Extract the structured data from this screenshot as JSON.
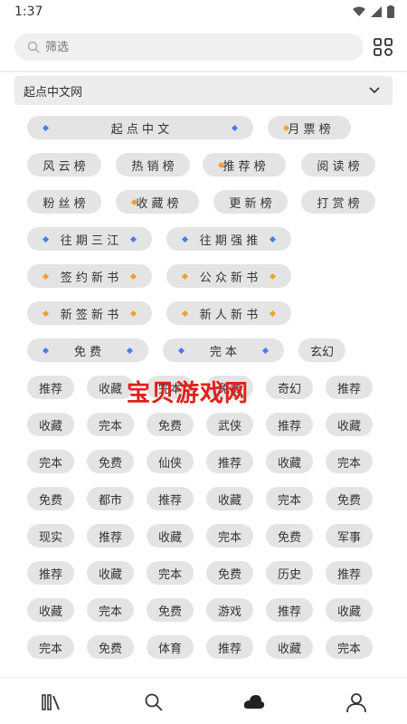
{
  "status": {
    "time": "1:37"
  },
  "search": {
    "placeholder": "筛选"
  },
  "source": {
    "selected": "起点中文网"
  },
  "tags": [
    {
      "label": "起 点 中 文",
      "dots": "both",
      "colors": [
        "#4a7be8",
        "#4a7be8"
      ]
    },
    {
      "label": "月 票 榜",
      "dots": "left",
      "colors": [
        "#f0a030"
      ]
    },
    {
      "label": "风 云 榜",
      "dots": "none"
    },
    {
      "label": "热 销 榜",
      "dots": "none"
    },
    {
      "label": "推 荐 榜",
      "dots": "left",
      "colors": [
        "#f0a030"
      ]
    },
    {
      "label": "阅 读 榜",
      "dots": "none"
    },
    {
      "label": "粉 丝 榜",
      "dots": "none"
    },
    {
      "label": "收 藏 榜",
      "dots": "left",
      "colors": [
        "#f0a030"
      ]
    },
    {
      "label": "更 新 榜",
      "dots": "none"
    },
    {
      "label": "打 赏 榜",
      "dots": "none"
    },
    {
      "label": "往 期 三 江",
      "dots": "both",
      "colors": [
        "#4a7be8",
        "#4a7be8"
      ]
    },
    {
      "label": "往 期 强 推",
      "dots": "both",
      "colors": [
        "#4a7be8",
        "#4a7be8"
      ]
    },
    {
      "label": "签 约 新 书",
      "dots": "both",
      "colors": [
        "#f0a030",
        "#f0a030"
      ]
    },
    {
      "label": "公 众 新 书",
      "dots": "both",
      "colors": [
        "#f0a030",
        "#f0a030"
      ]
    },
    {
      "label": "新 签 新 书",
      "dots": "both",
      "colors": [
        "#f0a030",
        "#f0a030"
      ]
    },
    {
      "label": "新 人 新 书",
      "dots": "both",
      "colors": [
        "#f0a030",
        "#f0a030"
      ]
    },
    {
      "label": "免 费",
      "dots": "both",
      "colors": [
        "#4a7be8",
        "#4a7be8"
      ]
    },
    {
      "label": "完 本",
      "dots": "both",
      "colors": [
        "#4a7be8",
        "#4a7be8"
      ]
    },
    {
      "label": "玄幻",
      "dots": "none"
    },
    {
      "label": "推荐"
    },
    {
      "label": "收藏"
    },
    {
      "label": "完本"
    },
    {
      "label": "免费"
    },
    {
      "label": "奇幻"
    },
    {
      "label": "推荐"
    },
    {
      "label": "收藏"
    },
    {
      "label": "完本"
    },
    {
      "label": "免费"
    },
    {
      "label": "武侠"
    },
    {
      "label": "推荐"
    },
    {
      "label": "收藏"
    },
    {
      "label": "完本"
    },
    {
      "label": "免费"
    },
    {
      "label": "仙侠"
    },
    {
      "label": "推荐"
    },
    {
      "label": "收藏"
    },
    {
      "label": "完本"
    },
    {
      "label": "免费"
    },
    {
      "label": "都市"
    },
    {
      "label": "推荐"
    },
    {
      "label": "收藏"
    },
    {
      "label": "完本"
    },
    {
      "label": "免费"
    },
    {
      "label": "现实"
    },
    {
      "label": "推荐"
    },
    {
      "label": "收藏"
    },
    {
      "label": "完本"
    },
    {
      "label": "免费"
    },
    {
      "label": "军事"
    },
    {
      "label": "推荐"
    },
    {
      "label": "收藏"
    },
    {
      "label": "完本"
    },
    {
      "label": "免费"
    },
    {
      "label": "历史"
    },
    {
      "label": "推荐"
    },
    {
      "label": "收藏"
    },
    {
      "label": "完本"
    },
    {
      "label": "免费"
    },
    {
      "label": "游戏"
    },
    {
      "label": "推荐"
    },
    {
      "label": "收藏"
    },
    {
      "label": "完本"
    },
    {
      "label": "免费"
    },
    {
      "label": "体育"
    },
    {
      "label": "推荐"
    },
    {
      "label": "收藏"
    },
    {
      "label": "完本"
    }
  ],
  "watermark": "宝贝游戏网",
  "nav": {
    "items": [
      {
        "icon": "bookshelf-icon"
      },
      {
        "icon": "search-icon"
      },
      {
        "icon": "cloud-icon"
      },
      {
        "icon": "user-icon"
      }
    ],
    "active_color": "#222222"
  }
}
